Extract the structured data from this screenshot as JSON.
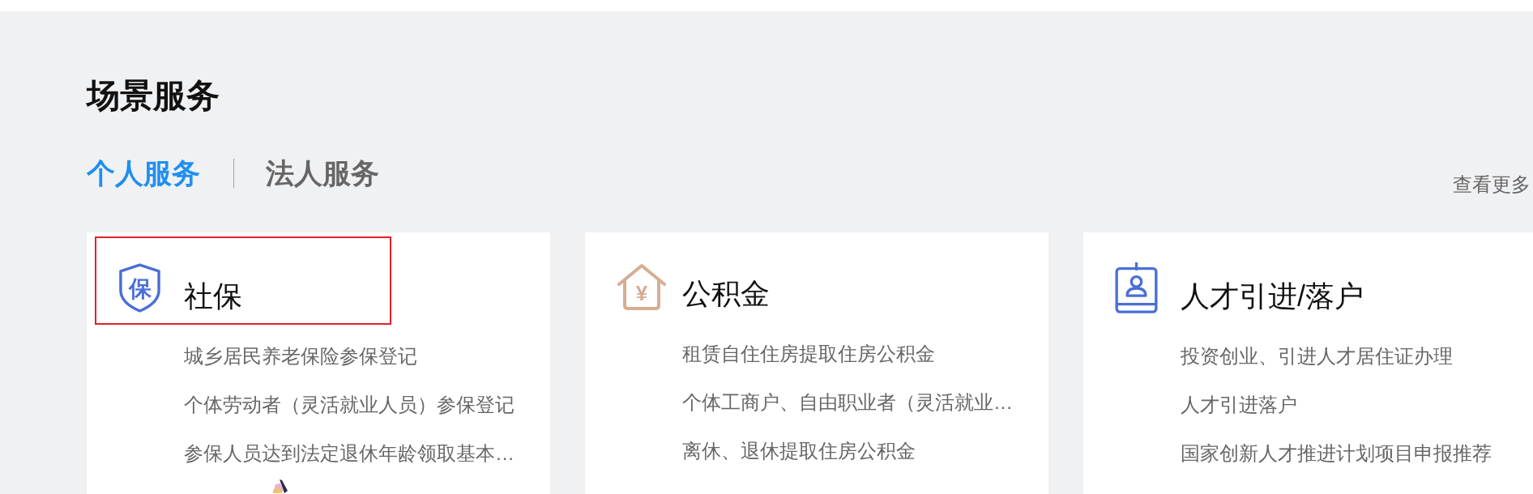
{
  "section": {
    "title": "场景服务"
  },
  "tabs": [
    {
      "label": "个人服务",
      "selected": true
    },
    {
      "label": "法人服务",
      "selected": false
    }
  ],
  "more_link": {
    "label": "查看更多"
  },
  "cards": [
    {
      "kind": "shield",
      "glyph": "保",
      "title": "社保",
      "highlighted": true,
      "illustration": true,
      "items": [
        "城乡居民养老保险参保登记",
        "个体劳动者（灵活就业人员）参保登记",
        "参保人员达到法定退休年龄领取基本…"
      ]
    },
    {
      "kind": "house",
      "glyph": "¥",
      "title": "公积金",
      "highlighted": false,
      "illustration": false,
      "items": [
        "租赁自住住房提取住房公积金",
        "个体工商户、自由职业者（灵活就业…",
        "离休、退休提取住房公积金"
      ]
    },
    {
      "kind": "badge",
      "title": "人才引进/落户",
      "highlighted": false,
      "illustration": false,
      "items": [
        "投资创业、引进人才居住证办理",
        "人才引进落户",
        "国家创新人才推进计划项目申报推荐"
      ]
    }
  ]
}
